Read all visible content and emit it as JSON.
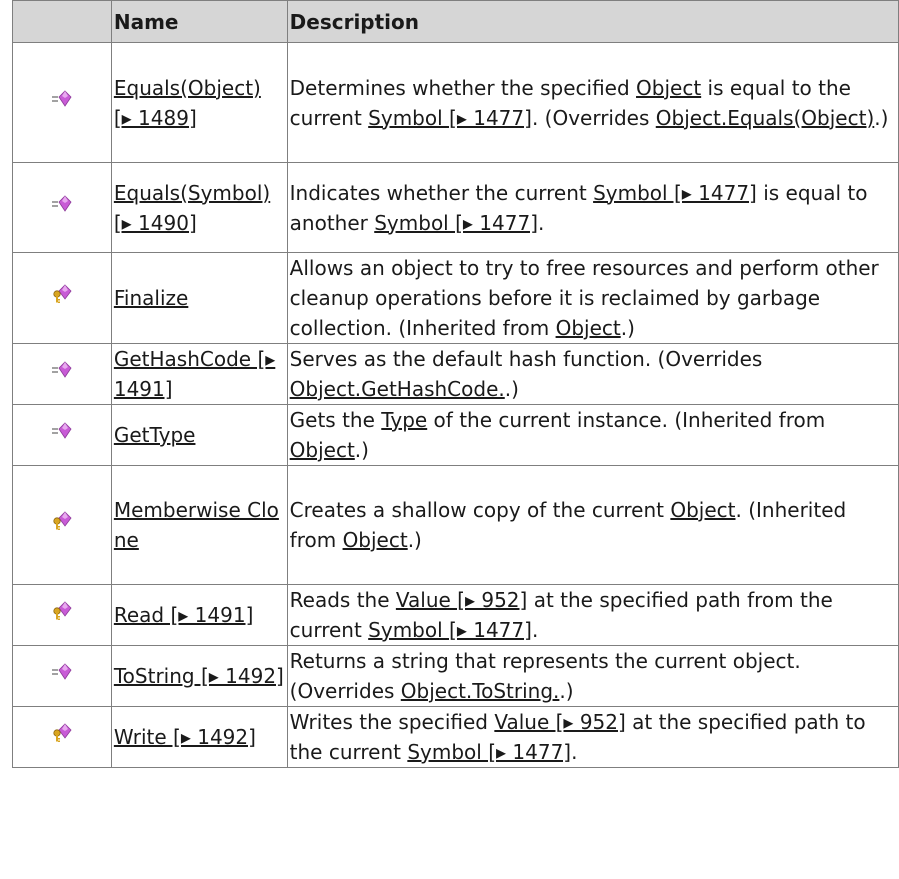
{
  "header": {
    "col_icon": "",
    "col_name": "Name",
    "col_desc": "Description"
  },
  "icons": {
    "public": "public-method-icon",
    "protected": "protected-method-icon"
  },
  "colors": {
    "header_bg": "#d6d6d6",
    "gem": "#c85bd6",
    "key": "#d9a520"
  },
  "rows": [
    {
      "icon": "public",
      "name": [
        {
          "t": "Equals(Object) [▸ 1489]",
          "link": true
        }
      ],
      "desc": [
        {
          "t": "Determines whether the specified "
        },
        {
          "t": "Object",
          "link": true
        },
        {
          "t": " is equal to the current "
        },
        {
          "t": "Symbol [▸ 1477]",
          "link": true
        },
        {
          "t": ". (Overrides "
        },
        {
          "t": "Object.Equals(Object)",
          "link": true
        },
        {
          "t": ".)"
        }
      ]
    },
    {
      "icon": "public",
      "name": [
        {
          "t": "Equals(Symbol) [▸ 1490]",
          "link": true
        }
      ],
      "desc": [
        {
          "t": "Indicates whether the current "
        },
        {
          "t": "Symbol [▸ 1477]",
          "link": true
        },
        {
          "t": " is equal to another "
        },
        {
          "t": "Symbol [▸ 1477]",
          "link": true
        },
        {
          "t": "."
        }
      ]
    },
    {
      "icon": "protected",
      "name": [
        {
          "t": "Finalize",
          "link": true
        }
      ],
      "desc": [
        {
          "t": "Allows an object to try to free resources and perform other cleanup operations before it is reclaimed by garbage collection. (Inherited from "
        },
        {
          "t": "Object",
          "link": true
        },
        {
          "t": ".)"
        }
      ]
    },
    {
      "icon": "public",
      "name": [
        {
          "t": "GetHashCode [▸ 1491]",
          "link": true
        }
      ],
      "desc": [
        {
          "t": "Serves as the default hash function. (Overrides "
        },
        {
          "t": "Object.GetHashCode.",
          "link": true
        },
        {
          "t": ".)"
        }
      ]
    },
    {
      "icon": "public",
      "name": [
        {
          "t": "GetType",
          "link": true
        }
      ],
      "desc": [
        {
          "t": "Gets the "
        },
        {
          "t": "Type",
          "link": true
        },
        {
          "t": " of the current instance. (Inherited from "
        },
        {
          "t": "Object",
          "link": true
        },
        {
          "t": ".)"
        }
      ]
    },
    {
      "icon": "protected",
      "name": [
        {
          "t": "Memberwise Clone",
          "link": true
        }
      ],
      "desc": [
        {
          "t": "Creates a shallow copy of the current "
        },
        {
          "t": "Object",
          "link": true
        },
        {
          "t": ". (Inherited from "
        },
        {
          "t": "Object",
          "link": true
        },
        {
          "t": ".)"
        }
      ]
    },
    {
      "icon": "protected",
      "name": [
        {
          "t": "Read [▸ 1491]",
          "link": true
        }
      ],
      "desc": [
        {
          "t": "Reads the "
        },
        {
          "t": "Value [▸ 952]",
          "link": true
        },
        {
          "t": " at the specified path from the current "
        },
        {
          "t": "Symbol [▸ 1477]",
          "link": true
        },
        {
          "t": "."
        }
      ]
    },
    {
      "icon": "public",
      "name": [
        {
          "t": "ToString [▸ 1492]",
          "link": true
        }
      ],
      "desc": [
        {
          "t": "Returns a string that represents the current object. (Overrides "
        },
        {
          "t": "Object.ToString.",
          "link": true
        },
        {
          "t": ".)"
        }
      ]
    },
    {
      "icon": "protected",
      "name": [
        {
          "t": "Write [▸ 1492]",
          "link": true
        }
      ],
      "desc": [
        {
          "t": "Writes the specified "
        },
        {
          "t": "Value [▸ 952]",
          "link": true
        },
        {
          "t": " at the specified path to the current "
        },
        {
          "t": "Symbol [▸ 1477]",
          "link": true
        },
        {
          "t": "."
        }
      ]
    }
  ]
}
